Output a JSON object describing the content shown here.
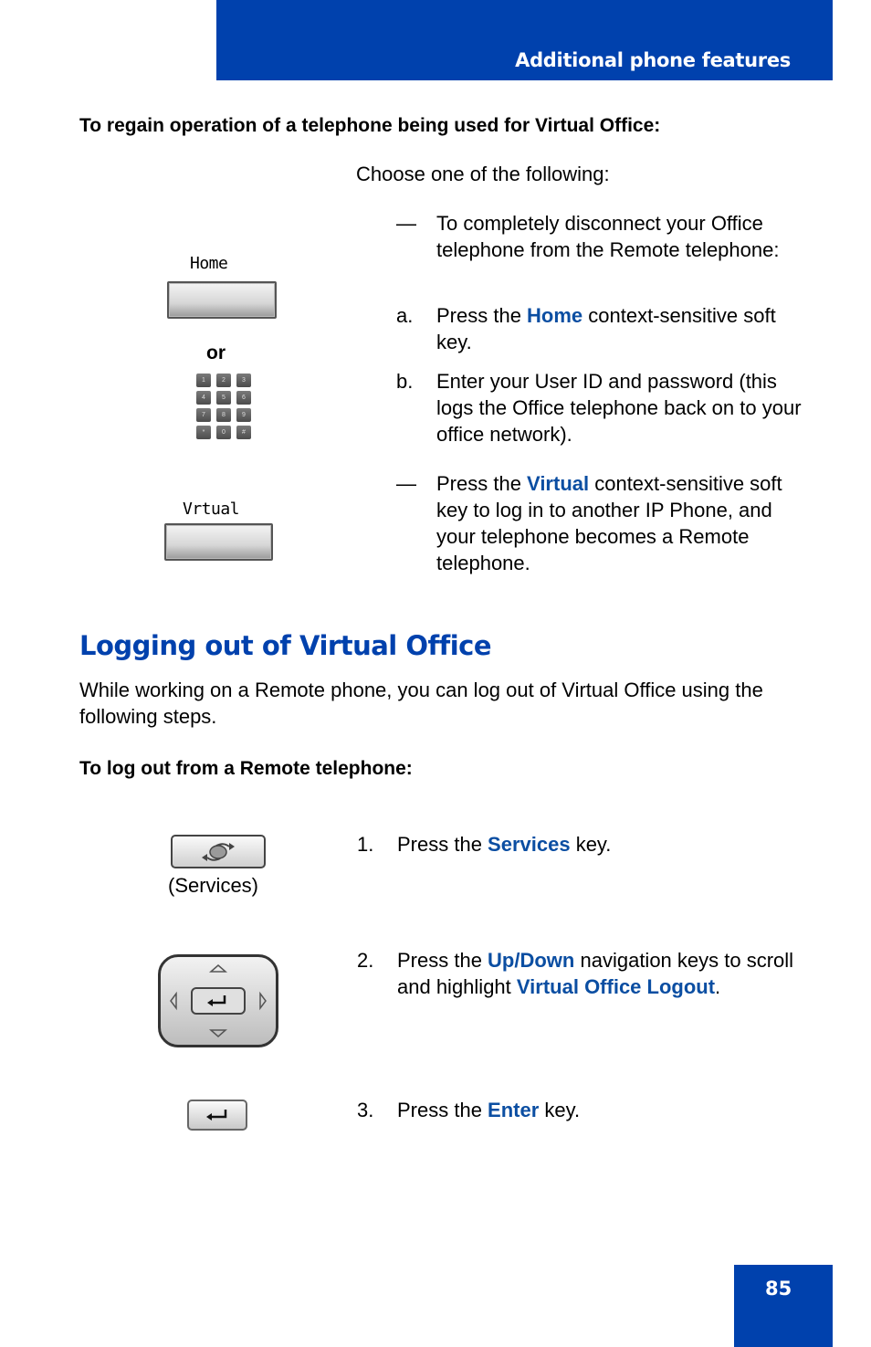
{
  "header": {
    "title": "Additional phone features"
  },
  "regain_section": {
    "heading": "To regain operation of a telephone being used for Virtual Office:",
    "intro": "Choose one of the following:",
    "option1": {
      "marker": "—",
      "text": "To completely disconnect your Office telephone from the Remote telephone:",
      "step_a": {
        "marker": "a.",
        "pre": "Press the ",
        "highlight": "Home",
        "post": " context-sensitive soft key."
      },
      "step_b": {
        "marker": "b.",
        "text": "Enter your User ID and password (this logs the Office telephone back on to your office network)."
      }
    },
    "option2": {
      "marker": "—",
      "pre": "Press the ",
      "highlight": "Virtual",
      "post": " context-sensitive soft key to log in to another IP Phone, and your telephone becomes a Remote telephone."
    },
    "images": {
      "home_softkey_label": "Home",
      "or_label": "or",
      "keypad_keys": [
        "1",
        "2",
        "3",
        "4",
        "5",
        "6",
        "7",
        "8",
        "9",
        "*",
        "0",
        "#"
      ],
      "virtual_softkey_label": "Vrtual"
    }
  },
  "logout_section": {
    "title": "Logging out of Virtual Office",
    "intro": "While working on a Remote phone, you can log out of Virtual Office using the following steps.",
    "procedure_heading": "To log out from a Remote telephone:",
    "services_caption": "(Services)",
    "steps": [
      {
        "marker": "1.",
        "pre": "Press the ",
        "highlight": "Services",
        "post": " key."
      },
      {
        "marker": "2.",
        "pre": "Press the ",
        "highlight": "Up/Down",
        "mid": " navigation keys to scroll and highlight ",
        "highlight2": "Virtual Office Logout",
        "post": "."
      },
      {
        "marker": "3.",
        "pre": "Press the ",
        "highlight": "Enter",
        "post": " key."
      }
    ]
  },
  "footer": {
    "page_number": "85"
  },
  "colors": {
    "brand_blue": "#0041ad",
    "highlight_blue": "#0b4ea2"
  }
}
